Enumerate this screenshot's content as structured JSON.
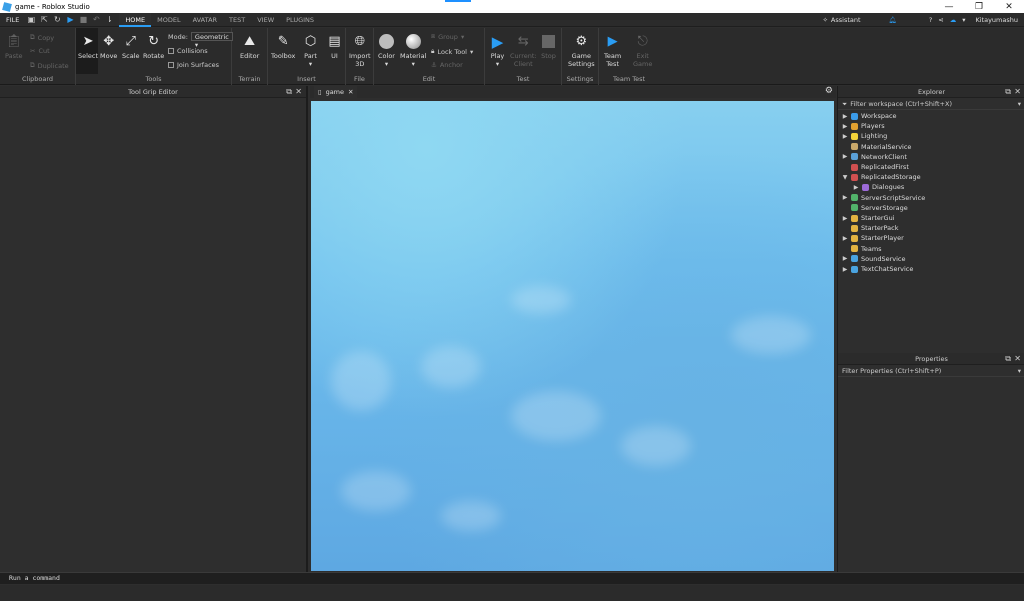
{
  "window": {
    "title": "game - Roblox Studio",
    "controls": [
      "—",
      "❐",
      "✕"
    ]
  },
  "menubar": {
    "file": "FILE",
    "tabs": [
      "HOME",
      "MODEL",
      "AVATAR",
      "TEST",
      "VIEW",
      "PLUGINS"
    ],
    "active_tab": "HOME",
    "assistant": "Assistant",
    "user": "Kitayumashu"
  },
  "ribbon": {
    "clipboard": {
      "label": "Clipboard",
      "paste": "Paste",
      "copy": "Copy",
      "cut": "Cut",
      "duplicate": "Duplicate"
    },
    "tools": {
      "label": "Tools",
      "select": "Select",
      "move": "Move",
      "scale": "Scale",
      "rotate": "Rotate",
      "mode_label": "Mode:",
      "mode_value": "Geometric",
      "collisions": "Collisions",
      "join_surfaces": "Join Surfaces"
    },
    "terrain": {
      "label": "Terrain",
      "editor": "Editor"
    },
    "insert": {
      "label": "Insert",
      "toolbox": "Toolbox",
      "part": "Part",
      "ui": "UI"
    },
    "file": {
      "label": "File",
      "import3d_1": "Import",
      "import3d_2": "3D"
    },
    "edit": {
      "label": "Edit",
      "color": "Color",
      "material": "Material",
      "group": "Group",
      "lock_tool": "Lock Tool",
      "anchor": "Anchor"
    },
    "test": {
      "label": "Test",
      "play": "Play",
      "current_client_1": "Current:",
      "current_client_2": "Client",
      "stop": "Stop"
    },
    "settings": {
      "label": "Settings",
      "game_settings_1": "Game",
      "game_settings_2": "Settings"
    },
    "team_test": {
      "label": "Team Test",
      "team_test_1": "Team",
      "team_test_2": "Test",
      "exit_game_1": "Exit",
      "exit_game_2": "Game"
    }
  },
  "left_panel": {
    "title": "Tool Grip Editor"
  },
  "viewport": {
    "tab": "game"
  },
  "explorer": {
    "title": "Explorer",
    "filter": "Filter workspace (Ctrl+Shift+X)",
    "items": [
      {
        "label": "Workspace",
        "arrow": "▶",
        "color": "#3b9be8",
        "indent": 0
      },
      {
        "label": "Players",
        "arrow": "▶",
        "color": "#e0a030",
        "indent": 0
      },
      {
        "label": "Lighting",
        "arrow": "▶",
        "color": "#f2d23a",
        "indent": 0
      },
      {
        "label": "MaterialService",
        "arrow": "",
        "color": "#c9a86a",
        "indent": 0
      },
      {
        "label": "NetworkClient",
        "arrow": "▶",
        "color": "#5aa0d8",
        "indent": 0
      },
      {
        "label": "ReplicatedFirst",
        "arrow": "",
        "color": "#d05050",
        "indent": 0
      },
      {
        "label": "ReplicatedStorage",
        "arrow": "▼",
        "color": "#d05050",
        "indent": 0
      },
      {
        "label": "Dialogues",
        "arrow": "▶",
        "color": "#9c6ad8",
        "indent": 1
      },
      {
        "label": "ServerScriptService",
        "arrow": "▶",
        "color": "#52b36a",
        "indent": 0
      },
      {
        "label": "ServerStorage",
        "arrow": "",
        "color": "#52b36a",
        "indent": 0
      },
      {
        "label": "StarterGui",
        "arrow": "▶",
        "color": "#e3b341",
        "indent": 0
      },
      {
        "label": "StarterPack",
        "arrow": "",
        "color": "#e3b341",
        "indent": 0
      },
      {
        "label": "StarterPlayer",
        "arrow": "▶",
        "color": "#e3b341",
        "indent": 0
      },
      {
        "label": "Teams",
        "arrow": "",
        "color": "#e3b341",
        "indent": 0
      },
      {
        "label": "SoundService",
        "arrow": "▶",
        "color": "#4aa3df",
        "indent": 0
      },
      {
        "label": "TextChatService",
        "arrow": "▶",
        "color": "#4aa3df",
        "indent": 0
      }
    ]
  },
  "properties": {
    "title": "Properties",
    "filter": "Filter Properties (Ctrl+Shift+P)"
  },
  "command_bar": {
    "text": "Run a command"
  }
}
